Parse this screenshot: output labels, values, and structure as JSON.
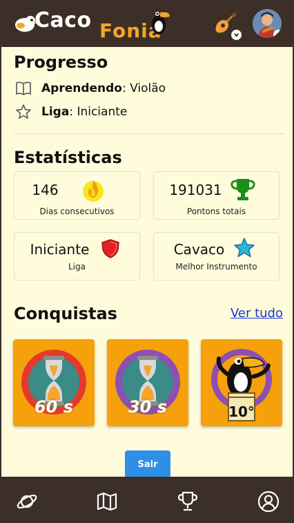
{
  "header": {
    "logo_part1": "Caco",
    "logo_part2": "Fonia",
    "instrument_icon": "guitar-icon",
    "user_icon": "avatar"
  },
  "progress": {
    "title": "Progresso",
    "learning_label": "Aprendendo",
    "learning_value": ": Violão",
    "league_label": "Liga",
    "league_value": ": Iniciante"
  },
  "stats": {
    "title": "Estatísticas",
    "cards": [
      {
        "value": "146",
        "label": "Dias consecutivos",
        "icon": "fire-icon"
      },
      {
        "value": "191031",
        "label": "Pontons totais",
        "icon": "trophy-icon"
      },
      {
        "value": "Iniciante",
        "label": "Liga",
        "icon": "shield-icon"
      },
      {
        "value": "Cavaco",
        "label": "Melhor Instrumento",
        "icon": "star-icon"
      }
    ]
  },
  "achievements": {
    "title": "Conquistas",
    "see_all": "Ver tudo",
    "items": [
      {
        "label": "60 s",
        "icon": "hourglass-icon"
      },
      {
        "label": "30 s",
        "icon": "hourglass-icon"
      },
      {
        "label": "10°",
        "icon": "toucan-icon"
      }
    ]
  },
  "logout_label": "Sair",
  "bottom_nav": [
    "planet-icon",
    "map-icon",
    "trophy-icon",
    "profile-icon"
  ],
  "colors": {
    "bar": "#3b2f28",
    "background": "#fffcdc",
    "accent_orange": "#f6a10b",
    "button_blue": "#2e8fe6",
    "link_blue": "#1a35d6"
  }
}
